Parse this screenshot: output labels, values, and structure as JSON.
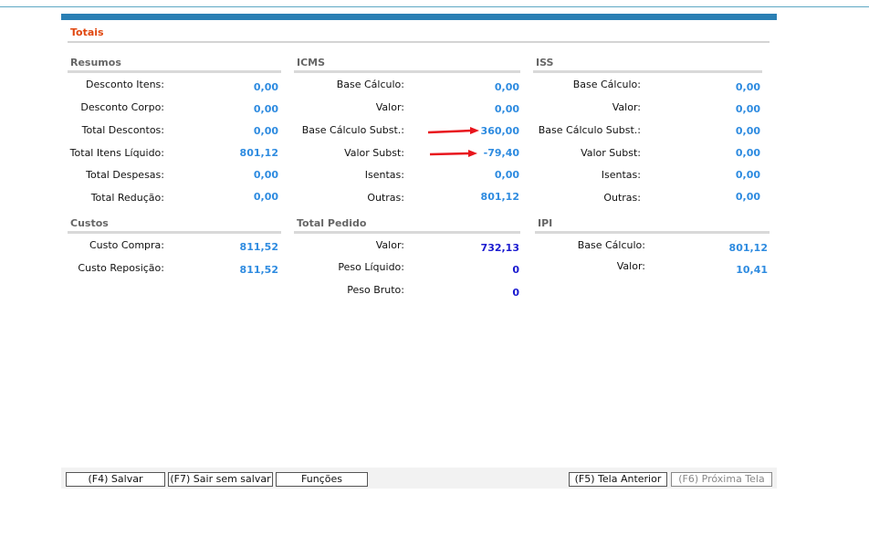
{
  "header": {
    "title": "Totais"
  },
  "sections": {
    "resumos": {
      "title": "Resumos",
      "rows": [
        {
          "label": "Desconto Itens:",
          "value": "0,00"
        },
        {
          "label": "Desconto Corpo:",
          "value": "0,00"
        },
        {
          "label": "Total Descontos:",
          "value": "0,00"
        },
        {
          "label": "Total Itens Líquido:",
          "value": "801,12"
        },
        {
          "label": "Total Despesas:",
          "value": "0,00"
        },
        {
          "label": "Total Redução:",
          "value": "0,00"
        }
      ]
    },
    "icms": {
      "title": "ICMS",
      "rows": [
        {
          "label": "Base Cálculo:",
          "value": "0,00"
        },
        {
          "label": "Valor:",
          "value": "0,00"
        },
        {
          "label": "Base Cálculo Subst.:",
          "value": "360,00"
        },
        {
          "label": "Valor Subst:",
          "value": "-79,40"
        },
        {
          "label": "Isentas:",
          "value": "0,00"
        },
        {
          "label": "Outras:",
          "value": "801,12"
        }
      ]
    },
    "iss": {
      "title": "ISS",
      "rows": [
        {
          "label": "Base Cálculo:",
          "value": "0,00"
        },
        {
          "label": "Valor:",
          "value": "0,00"
        },
        {
          "label": "Base Cálculo Subst.:",
          "value": "0,00"
        },
        {
          "label": "Valor Subst:",
          "value": "0,00"
        },
        {
          "label": "Isentas:",
          "value": "0,00"
        },
        {
          "label": "Outras:",
          "value": "0,00"
        }
      ]
    },
    "custos": {
      "title": "Custos",
      "rows": [
        {
          "label": "Custo Compra:",
          "value": "811,52"
        },
        {
          "label": "Custo Reposição:",
          "value": "811,52"
        }
      ]
    },
    "total_pedido": {
      "title": "Total Pedido",
      "rows": [
        {
          "label": "Valor:",
          "value": "732,13"
        },
        {
          "label": "Peso Líquido:",
          "value": "0"
        },
        {
          "label": "Peso Bruto:",
          "value": "0"
        }
      ]
    },
    "ipi": {
      "title": "IPI",
      "rows": [
        {
          "label": "Base Cálculo:",
          "value": "801,12"
        },
        {
          "label": "Valor:",
          "value": "10,41"
        }
      ]
    }
  },
  "footer": {
    "save": "(F4) Salvar",
    "exit_no_save": "(F7) Sair sem salvar",
    "functions": "Funções",
    "previous": "(F5) Tela Anterior",
    "next": "(F6) Próxima Tela"
  },
  "colors": {
    "accent_bar": "#2a7fb4",
    "title_orange": "#e0470f",
    "value_blue": "#2e8be0",
    "value_dark_blue": "#1a1ad0",
    "annotation_arrow": "#e8141c"
  }
}
